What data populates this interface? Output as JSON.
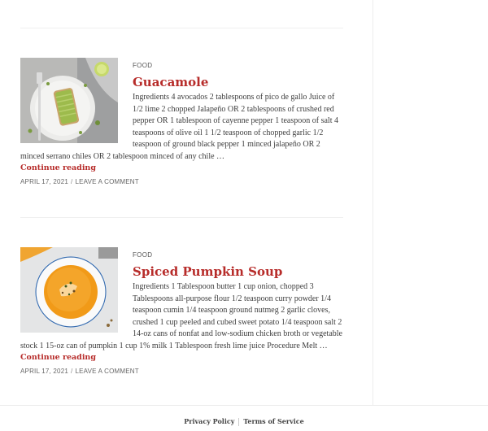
{
  "posts": [
    {
      "category": "FOOD",
      "title": "Guacamole",
      "excerpt": "Ingredients 4 avocados 2 tablespoons of pico de gallo Juice of 1/2 lime 2 chopped Jalapeño OR 2 tablespoons of crushed red pepper OR 1 tablespoon of cayenne pepper 1 teaspoon of salt 4 teaspoons of olive oil 1 1/2 teaspoon of chopped garlic 1/2 teaspoon of ground black pepper 1 minced jalapeño OR 2 minced serrano chiles OR 2 tablespoon minced of any chile …",
      "more": "Continue reading",
      "date": "APRIL 17, 2021",
      "comment": "LEAVE A COMMENT"
    },
    {
      "category": "FOOD",
      "title": "Spiced Pumpkin Soup",
      "excerpt": "Ingredients 1 Tablespoon butter 1 cup onion, chopped 3 Tablespoons all-purpose flour 1/2 teaspoon curry powder 1/4 teaspoon cumin 1/4 teaspoon ground nutmeg 2 garlic cloves, crushed 1 cup peeled and cubed sweet potato 1/4 teaspoon salt 2 14-oz cans of nonfat and low-sodium chicken broth or vegetable stock 1 15-oz can of pumpkin 1 cup 1% milk 1 Tablespoon fresh lime juice Procedure Melt …",
      "more": "Continue reading",
      "date": "APRIL 17, 2021",
      "comment": "LEAVE A COMMENT"
    }
  ],
  "meta_separator": "/",
  "footer": {
    "privacy": "Privacy Policy",
    "terms": "Terms of Service"
  },
  "images": {
    "guacamole": "avocado-toast-photo",
    "pumpkin_soup": "pumpkin-soup-bowl-photo"
  }
}
